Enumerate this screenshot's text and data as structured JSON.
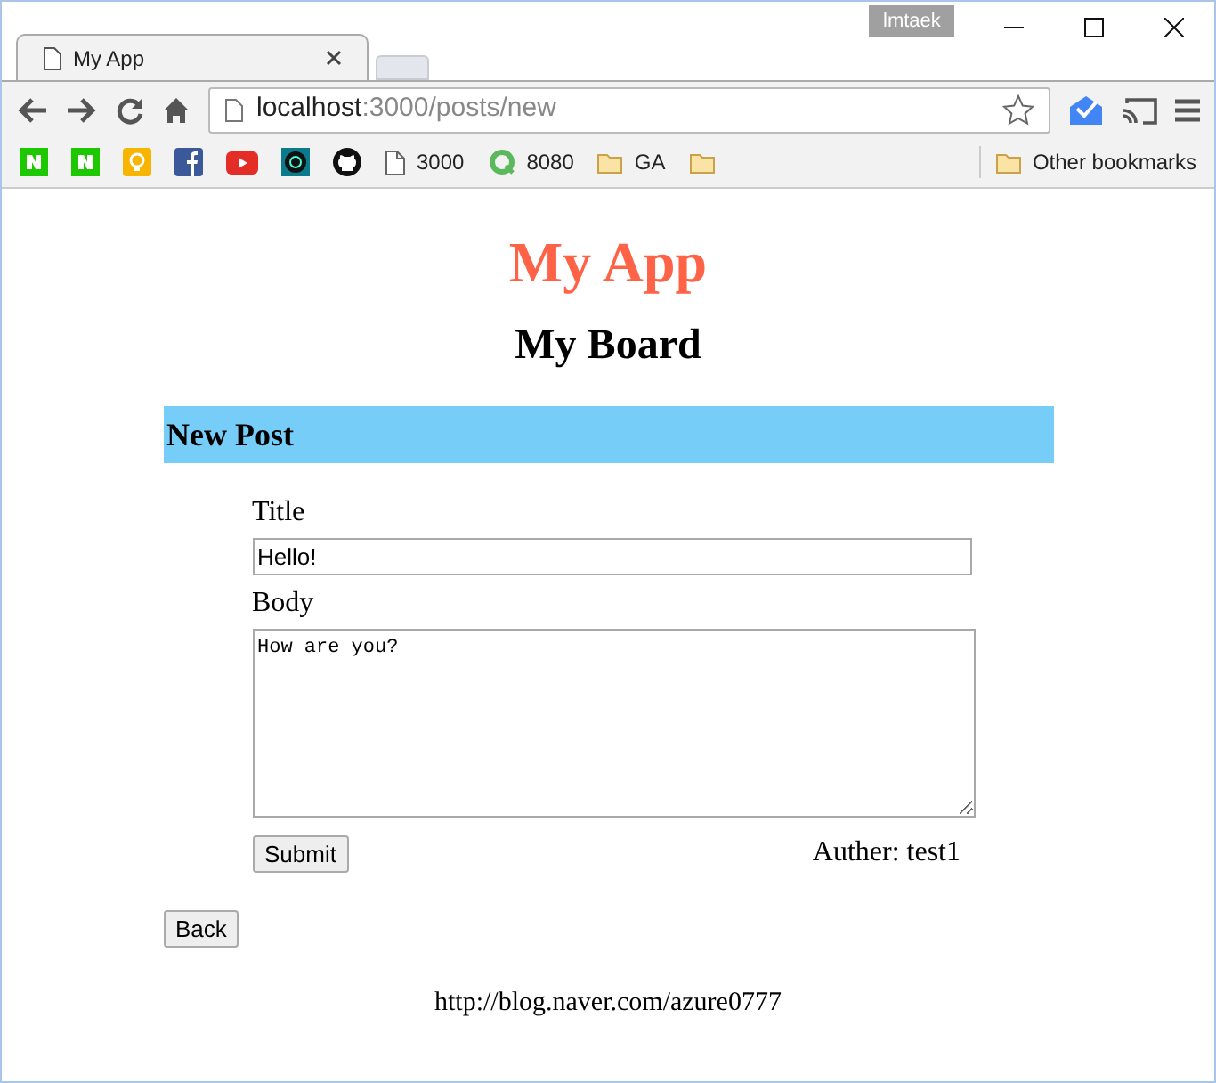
{
  "window": {
    "profile": "lmtaek"
  },
  "tabs": [
    {
      "title": "My App",
      "selected": true
    }
  ],
  "address_bar": {
    "host": "localhost",
    "path": ":3000/posts/new"
  },
  "bookmarks": [
    {
      "kind": "naver"
    },
    {
      "kind": "naver"
    },
    {
      "kind": "bulb"
    },
    {
      "kind": "facebook"
    },
    {
      "kind": "youtube"
    },
    {
      "kind": "code"
    },
    {
      "kind": "github"
    },
    {
      "kind": "page",
      "label": "3000"
    },
    {
      "kind": "ring",
      "label": "8080"
    },
    {
      "kind": "folder",
      "label": "GA"
    },
    {
      "kind": "folder"
    }
  ],
  "other_bookmarks": "Other bookmarks",
  "page": {
    "app_title": "My App",
    "board_title": "My Board",
    "section_title": "New Post",
    "form": {
      "title_label": "Title",
      "title_value": "Hello!",
      "body_label": "Body",
      "body_value": "How are you?",
      "submit": "Submit",
      "author": "Auther: test1"
    },
    "back": "Back",
    "footer": "http://blog.naver.com/azure0777"
  }
}
